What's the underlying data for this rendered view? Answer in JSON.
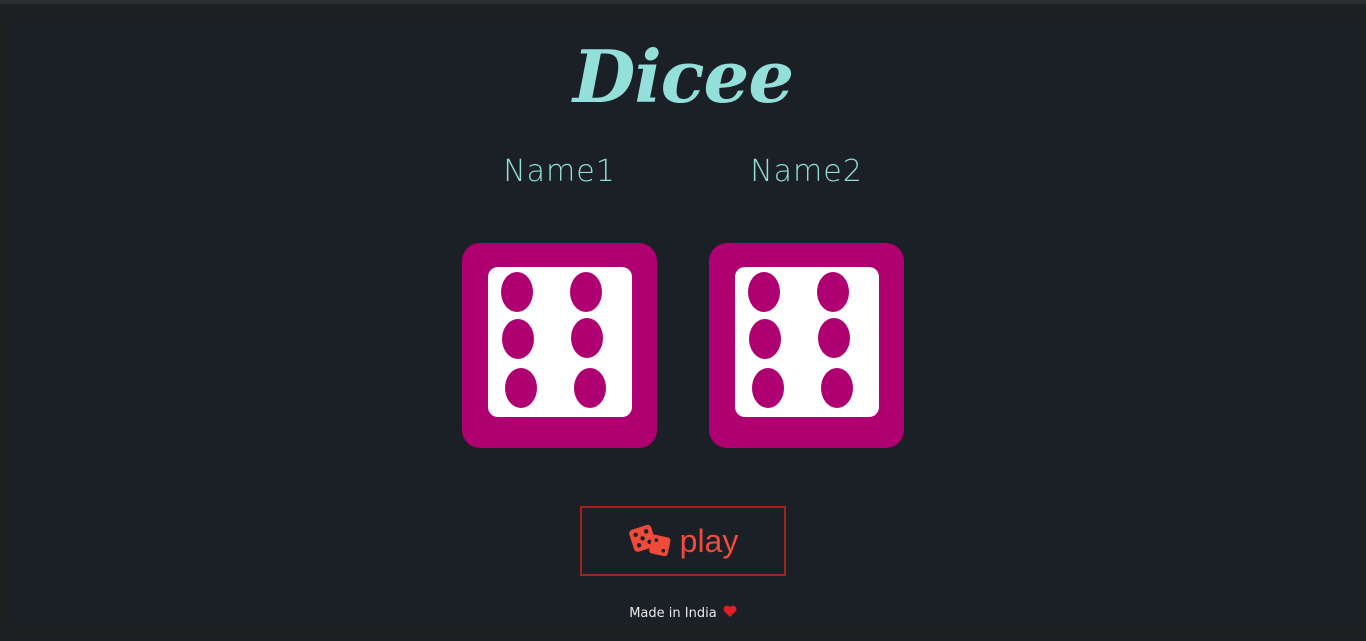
{
  "app": {
    "title": "Dicee"
  },
  "players": [
    {
      "name": "Name1",
      "die_value": 6
    },
    {
      "name": "Name2",
      "die_value": 6
    }
  ],
  "play_button": {
    "label": "play",
    "icon": "dice-icon"
  },
  "footer": {
    "text": "Made in India",
    "icon": "heart-icon"
  },
  "colors": {
    "accent": "#93dfd9",
    "die": "#ae0070",
    "button": "#ef4a3a",
    "background": "#1b1f26"
  }
}
